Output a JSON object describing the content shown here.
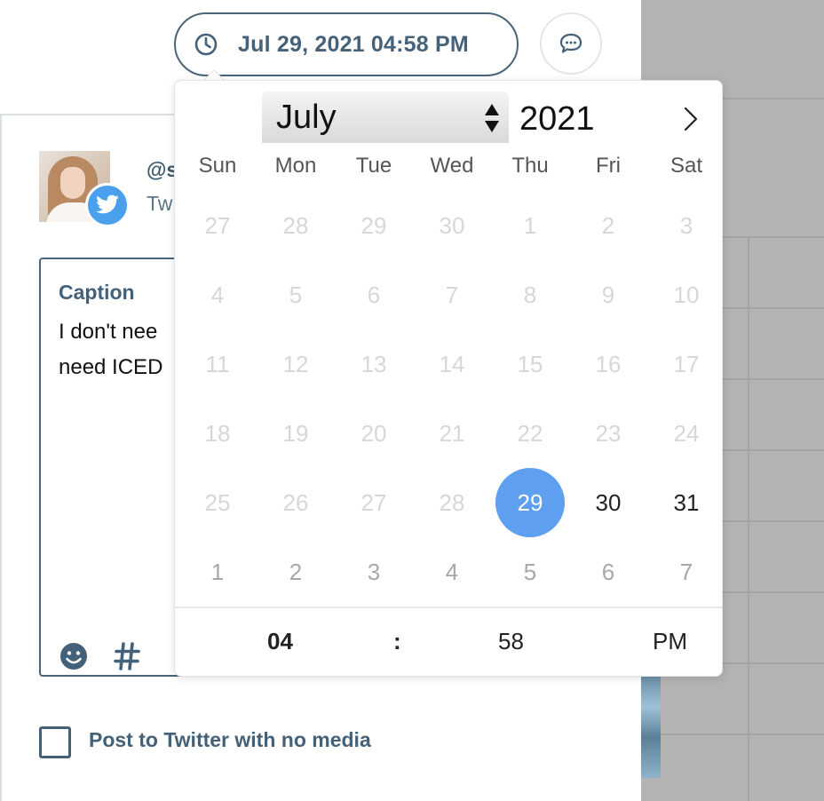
{
  "header": {
    "scheduled_datetime": "Jul 29, 2021 04:58 PM"
  },
  "profile": {
    "handle": "@s",
    "network": "Tw"
  },
  "caption": {
    "label": "Caption",
    "text": "I don't nee\nneed ICED"
  },
  "post_option": {
    "label": "Post to Twitter with no media",
    "checked": false
  },
  "datepicker": {
    "month": "July",
    "year": "2021",
    "weekdays": [
      "Sun",
      "Mon",
      "Tue",
      "Wed",
      "Thu",
      "Fri",
      "Sat"
    ],
    "weeks": [
      [
        "27",
        "28",
        "29",
        "30",
        "1",
        "2",
        "3"
      ],
      [
        "4",
        "5",
        "6",
        "7",
        "8",
        "9",
        "10"
      ],
      [
        "11",
        "12",
        "13",
        "14",
        "15",
        "16",
        "17"
      ],
      [
        "18",
        "19",
        "20",
        "21",
        "22",
        "23",
        "24"
      ],
      [
        "25",
        "26",
        "27",
        "28",
        "29",
        "30",
        "31"
      ],
      [
        "1",
        "2",
        "3",
        "4",
        "5",
        "6",
        "7"
      ]
    ],
    "selected_day": "29",
    "hour": "04",
    "separator": ":",
    "minute": "58",
    "meridiem": "PM",
    "selected_color": "#5e9ff0"
  },
  "icons": {
    "clock": "clock-icon",
    "comment": "comment-icon",
    "twitter": "twitter-icon",
    "emoji": "emoji-icon",
    "hashtag": "hashtag-icon",
    "next_month": "chevron-right-icon"
  },
  "colors": {
    "accent": "#46627a",
    "twitter_blue": "#4aa0ec",
    "backdrop": "#b3b3b3"
  }
}
